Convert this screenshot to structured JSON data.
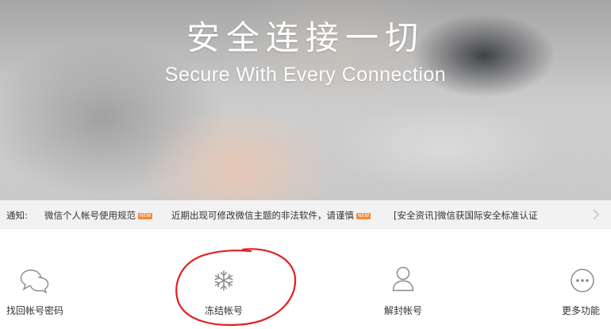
{
  "hero": {
    "title": "安全连接一切",
    "subtitle": "Secure With Every Connection"
  },
  "notice": {
    "label": "通知:",
    "items": [
      {
        "text": "微信个人帐号使用规范",
        "badge": "NEW"
      },
      {
        "text": "近期出现可修改微信主题的非法软件，请谨慎",
        "badge": "NEW"
      },
      {
        "text": "[安全资讯]微信获国际安全标准认证",
        "badge": ""
      }
    ]
  },
  "actions": [
    {
      "label": "找回帐号密码",
      "icon": "chat-bubbles-icon"
    },
    {
      "label": "冻结帐号",
      "icon": "snowflake-icon"
    },
    {
      "label": "解封帐号",
      "icon": "user-icon"
    },
    {
      "label": "更多功能",
      "icon": "more-dots-icon"
    }
  ],
  "colors": {
    "icon": "#8a8a8a",
    "annotation": "#e02020",
    "badge": "#f08a3c"
  }
}
